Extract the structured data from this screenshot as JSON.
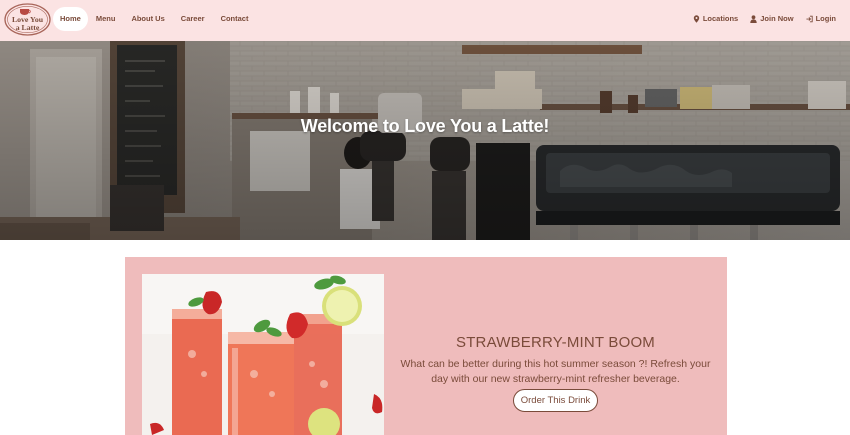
{
  "logo": {
    "line1": "Love You",
    "line2": "a Latte"
  },
  "nav": {
    "left": [
      "Home",
      "Menu",
      "About Us",
      "Career",
      "Contact"
    ],
    "right": [
      {
        "label": "Locations",
        "icon": "map-marker-icon"
      },
      {
        "label": "Join Now",
        "icon": "user-icon"
      },
      {
        "label": "Login",
        "icon": "login-icon"
      }
    ]
  },
  "hero": {
    "title": "Welcome to Love You a Latte!"
  },
  "feature": {
    "title": "STRAWBERRY-MINT BOOM",
    "description": "What can be better during this hot summer season ?! Refresh your day with our new strawberry-mint refresher beverage.",
    "button": "Order This Drink"
  },
  "colors": {
    "navbar_bg": "#fbe3e3",
    "text_brown": "#7a4b3a",
    "feature_bg": "#efbcbc"
  }
}
